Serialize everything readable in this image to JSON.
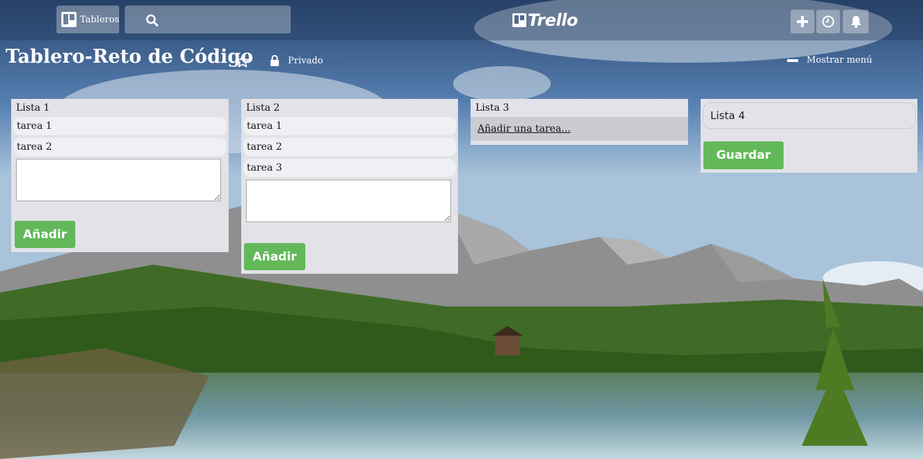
{
  "header": {
    "boards_label": "Tableros",
    "logo_text": "Trello"
  },
  "board": {
    "title": "Tablero-Reto de Código",
    "privacy": "Privado",
    "show_menu": "Mostrar menú"
  },
  "lists": [
    {
      "title": "Lista 1",
      "cards": [
        "tarea 1",
        "tarea 2"
      ],
      "add_button": "Añadir"
    },
    {
      "title": "Lista 2",
      "cards": [
        "tarea 1",
        "tarea 2",
        "tarea 3"
      ],
      "add_button": "Añadir"
    },
    {
      "title": "Lista 3",
      "add_card_link": "Añadir una tarea..."
    }
  ],
  "new_list": {
    "value": "Lista 4",
    "save_button": "Guardar"
  },
  "colors": {
    "accent_green": "#63b95a",
    "list_bg": "#e2e2e8"
  },
  "icons": {
    "boards": "boards-icon",
    "search": "search-icon",
    "add": "plus-icon",
    "info": "clock-icon",
    "notifications": "bell-icon",
    "star": "star-icon",
    "lock": "lock-icon",
    "menu": "minus-icon"
  }
}
